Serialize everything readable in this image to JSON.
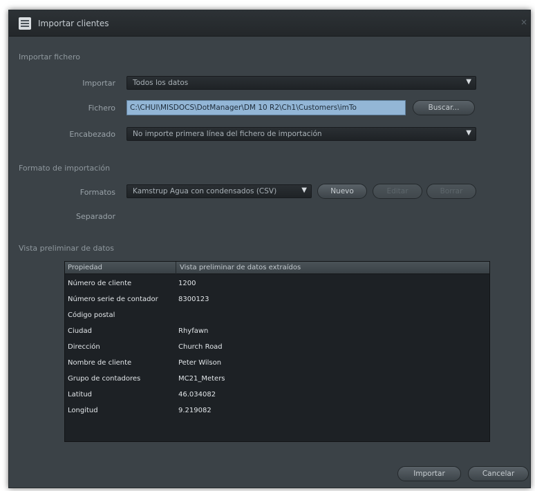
{
  "window": {
    "title": "Importar clientes",
    "close_label": "×"
  },
  "import_file": {
    "section_label": "Importar fichero",
    "import_label": "Importar",
    "import_value": "Todos los datos",
    "file_label": "Fichero",
    "file_value": "C:\\CHUI\\MISDOCS\\DotManager\\DM 10 R2\\Ch1\\Customers\\imTo",
    "browse_button": "Buscar...",
    "header_label": "Encabezado",
    "header_value": "No importe primera línea del fichero de importación"
  },
  "import_format": {
    "section_label": "Formato de importación",
    "format_label": "Formatos",
    "format_value": "Kamstrup Agua con condensados (CSV)",
    "new_button": "Nuevo",
    "edit_button": "Editar",
    "delete_button": "Borrar",
    "separator_label": "Separador"
  },
  "preview": {
    "section_label": "Vista preliminar de datos",
    "col_property": "Propiedad",
    "col_value": "Vista preliminar de datos extraídos",
    "rows": [
      {
        "property": "Número de cliente",
        "value": "1200"
      },
      {
        "property": "Número serie de contador",
        "value": "8300123"
      },
      {
        "property": "Código postal",
        "value": ""
      },
      {
        "property": "Ciudad",
        "value": "Rhyfawn"
      },
      {
        "property": "Dirección",
        "value": "Church Road"
      },
      {
        "property": "Nombre de cliente",
        "value": "Peter Wilson"
      },
      {
        "property": "Grupo de contadores",
        "value": "MC21_Meters"
      },
      {
        "property": "Latitud",
        "value": "46.034082"
      },
      {
        "property": "Longitud",
        "value": "9.219082"
      }
    ]
  },
  "footer": {
    "import_button": "Importar",
    "cancel_button": "Cancelar"
  },
  "colors": {
    "window_bg": "#3b4247",
    "selection": "#93b6d6",
    "preview_bg": "#1d2125"
  }
}
